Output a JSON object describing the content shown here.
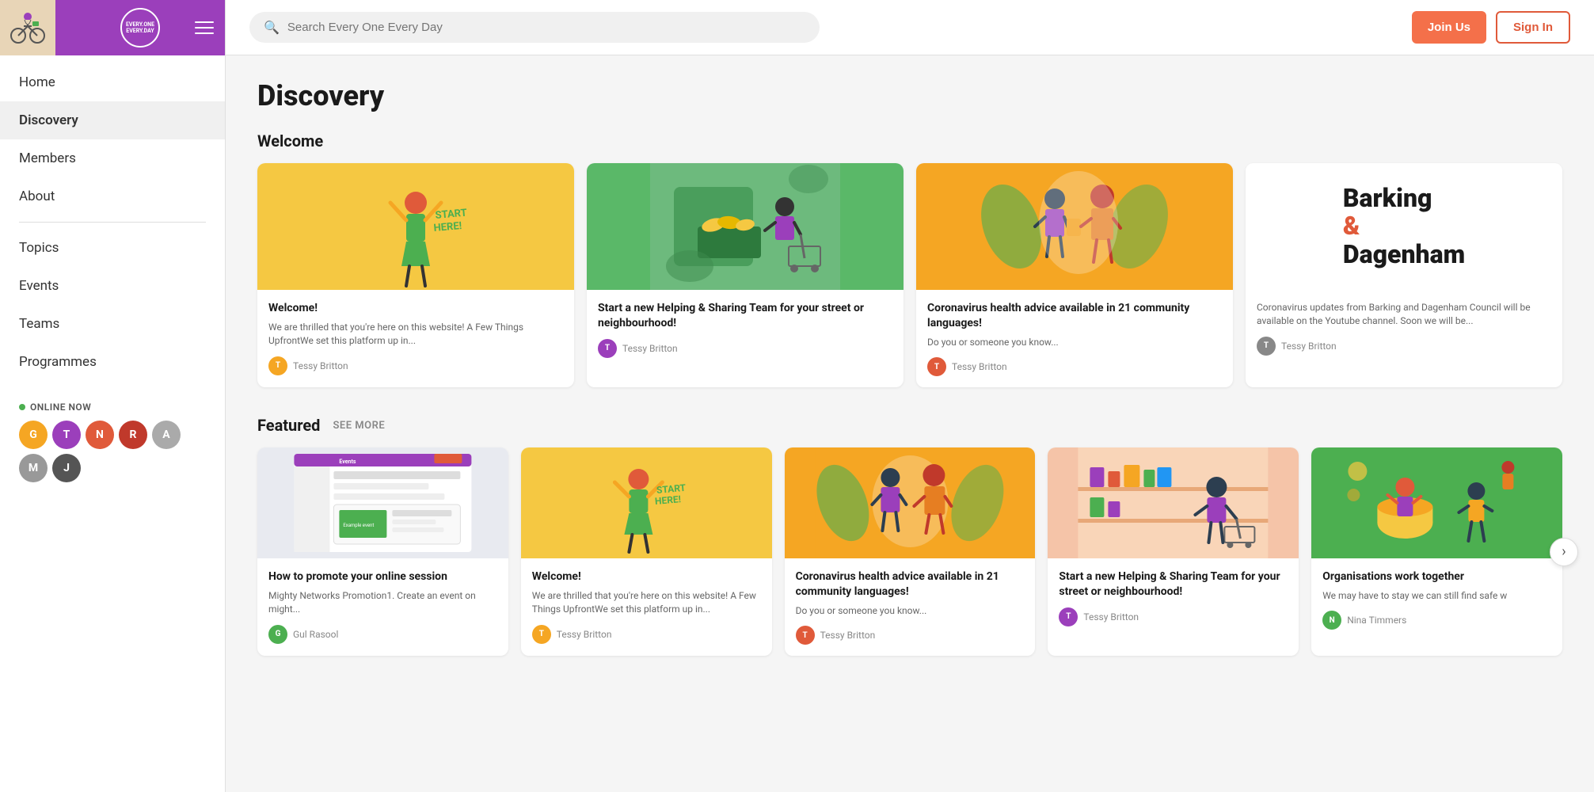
{
  "sidebar": {
    "nav_items": [
      {
        "id": "home",
        "label": "Home",
        "active": false
      },
      {
        "id": "discovery",
        "label": "Discovery",
        "active": true
      },
      {
        "id": "members",
        "label": "Members",
        "active": false
      },
      {
        "id": "about",
        "label": "About",
        "active": false
      },
      {
        "id": "topics",
        "label": "Topics",
        "active": false
      },
      {
        "id": "events",
        "label": "Events",
        "active": false
      },
      {
        "id": "teams",
        "label": "Teams",
        "active": false
      },
      {
        "id": "programmes",
        "label": "Programmes",
        "active": false
      }
    ],
    "online_label": "ONLINE NOW",
    "brand_text": "EVERY.ONE EVERY.DAY",
    "avatars": [
      {
        "id": "a1",
        "color": "#f5a623",
        "initial": "G"
      },
      {
        "id": "a2",
        "color": "#9b3fbb",
        "initial": "T"
      },
      {
        "id": "a3",
        "color": "#e05a3a",
        "initial": "N"
      },
      {
        "id": "a4",
        "color": "#c0392b",
        "initial": "R"
      },
      {
        "id": "a5",
        "color": "#888",
        "initial": "A"
      },
      {
        "id": "a6",
        "color": "#aaa",
        "initial": "M"
      },
      {
        "id": "a7",
        "color": "#555",
        "initial": "J"
      }
    ]
  },
  "topbar": {
    "search_placeholder": "Search Every One Every Day",
    "join_label": "Join Us",
    "signin_label": "Sign In"
  },
  "content": {
    "page_title": "Discovery",
    "welcome_section": {
      "title": "Welcome",
      "cards": [
        {
          "id": "w1",
          "type": "illustration_yellow",
          "title": "Welcome!",
          "desc": "We are thrilled that you're here on this website! A Few Things UpfrontWe set this platform up in...",
          "author": "Tessy Britton",
          "author_color": "#f5a623"
        },
        {
          "id": "w2",
          "type": "illustration_green",
          "title": "Start a new Helping & Sharing Team for your street or neighbourhood!",
          "desc": "",
          "author": "Tessy Britton",
          "author_color": "#9b3fbb"
        },
        {
          "id": "w3",
          "type": "illustration_orange",
          "title": "Coronavirus health advice available in 21 community languages!",
          "desc": "Do you or someone you know...",
          "author": "Tessy Britton",
          "author_color": "#e05a3a"
        },
        {
          "id": "w4",
          "type": "barking",
          "title": "Barking & Dagenham",
          "desc": "Coronavirus updates from Barking and Dagenham Council will be available on the Youtube channel.  Soon we will be...",
          "author": "Tessy Britton",
          "author_color": "#888"
        }
      ]
    },
    "featured_section": {
      "title": "Featured",
      "see_more": "SEE MORE",
      "cards": [
        {
          "id": "f1",
          "type": "screenshot",
          "title": "How to promote your online session",
          "desc": "Mighty Networks Promotion1. Create an event on might...",
          "author": "Gul Rasool",
          "author_color": "#4caf50"
        },
        {
          "id": "f2",
          "type": "illustration_yellow",
          "title": "Welcome!",
          "desc": "We are thrilled that you're here on this website! A Few Things UpfrontWe set this platform up in...",
          "author": "Tessy Britton",
          "author_color": "#f5a623"
        },
        {
          "id": "f3",
          "type": "illustration_orange",
          "title": "Coronavirus health advice available in 21 community languages!",
          "desc": "Do you or someone you know...",
          "author": "Tessy Britton",
          "author_color": "#e05a3a"
        },
        {
          "id": "f4",
          "type": "illustration_green",
          "title": "Start a new Helping & Sharing Team for your street or neighbourhood!",
          "desc": "",
          "author": "Tessy Britton",
          "author_color": "#9b3fbb"
        },
        {
          "id": "f5",
          "type": "illustration_lime",
          "title": "Organisations work together",
          "desc": "We may have to stay we can still find safe w",
          "author": "Nina Timmers",
          "author_color": "#4caf50"
        }
      ]
    }
  }
}
